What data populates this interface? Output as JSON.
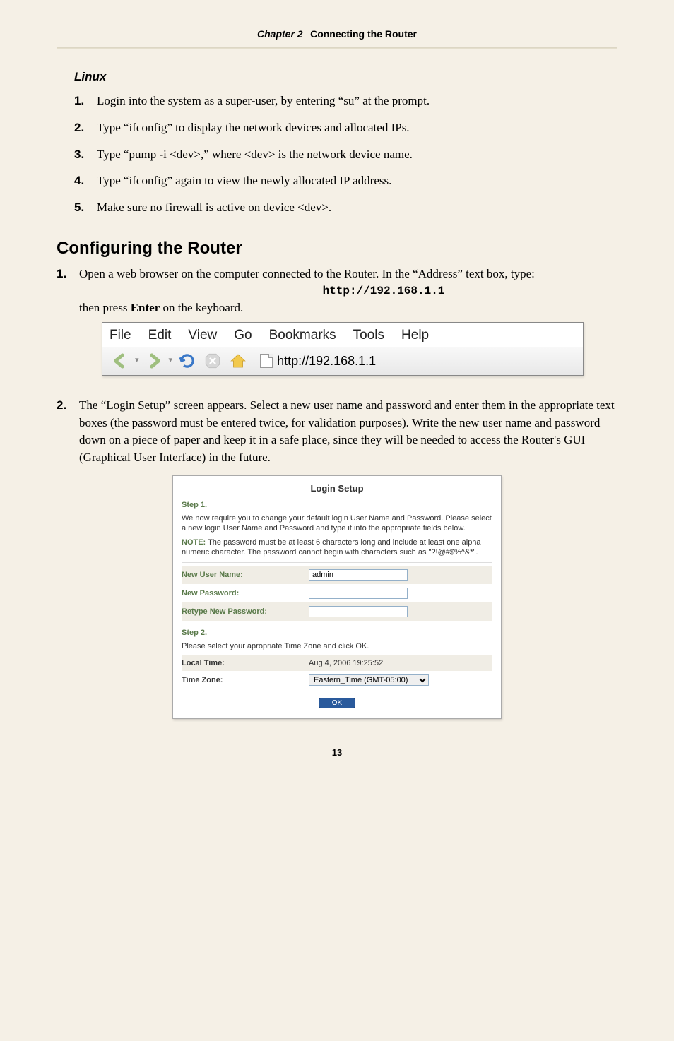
{
  "header": {
    "chapter": "Chapter 2",
    "title": "Connecting the Router"
  },
  "linux": {
    "heading": "Linux",
    "steps": [
      "Login into the system as a super-user, by entering “su” at the prompt.",
      "Type “ifconfig” to display the network devices and allocated IPs.",
      "Type “pump -i <dev>,” where <dev> is the network device name.",
      "Type “ifconfig” again to view the newly allocated IP address.",
      "Make sure no firewall is active on device <dev>."
    ]
  },
  "configuring": {
    "heading": "Configuring the Router",
    "step1a": "Open a web browser on the computer connected to the Router. In the “Address” text box, type:",
    "url": "http://192.168.1.1",
    "step1b_a": "then press ",
    "step1b_b": "Enter",
    "step1b_c": " on the keyboard.",
    "step2": "The “Login Setup” screen appears. Select a new user name and password and enter them in the appropriate text boxes (the password must be entered twice, for validation purposes). Write the new user name and password down on a piece of paper and keep it in a safe place, since they will be needed to access the Router's GUI (Graphical User Interface) in the future."
  },
  "browser": {
    "menu": [
      "File",
      "Edit",
      "View",
      "Go",
      "Bookmarks",
      "Tools",
      "Help"
    ],
    "url": "http://192.168.1.1"
  },
  "login": {
    "title": "Login Setup",
    "step1": "Step 1.",
    "intro": "We now require you to change your default login User Name and Password. Please select a new login User Name and Password and type it into the appropriate fields below.",
    "note_label": "NOTE:",
    "note": " The password must be at least 6 characters long and include at least one alpha numeric character. The password cannot begin with characters such as \"?!@#$%^&*\".",
    "new_user_label": "New User Name:",
    "new_user_value": "admin",
    "new_pw_label": "New Password:",
    "retype_pw_label": "Retype New Password:",
    "step2": "Step 2.",
    "step2_text": "Please select your apropriate Time Zone and click OK.",
    "local_time_label": "Local Time:",
    "local_time_value": "Aug 4, 2006 19:25:52",
    "tz_label": "Time Zone:",
    "tz_value": "Eastern_Time (GMT-05:00)",
    "ok": "OK"
  },
  "pagenum": "13"
}
